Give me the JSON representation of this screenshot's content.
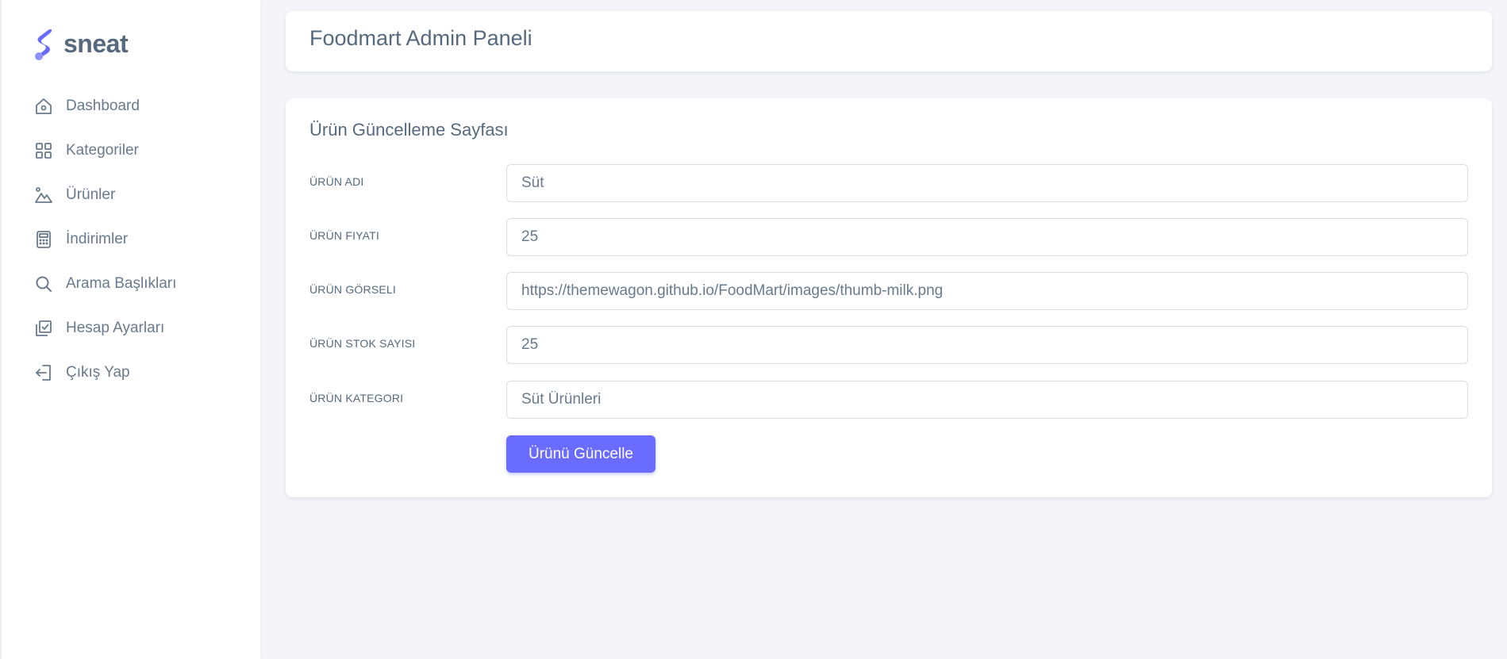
{
  "brand": {
    "name": "sneat",
    "accent_color": "#696cff"
  },
  "sidebar": {
    "items": [
      {
        "label": "Dashboard",
        "icon": "home-icon"
      },
      {
        "label": "Kategoriler",
        "icon": "grid-icon"
      },
      {
        "label": "Ürünler",
        "icon": "shapes-icon"
      },
      {
        "label": "İndirimler",
        "icon": "calculator-icon"
      },
      {
        "label": "Arama Başlıkları",
        "icon": "search-icon"
      },
      {
        "label": "Hesap Ayarları",
        "icon": "checkbox-icon"
      },
      {
        "label": "Çıkış Yap",
        "icon": "logout-icon"
      }
    ]
  },
  "header": {
    "title": "Foodmart Admin Paneli"
  },
  "form": {
    "title": "Ürün Güncelleme Sayfası",
    "fields": [
      {
        "label": "ÜRÜN ADI",
        "value": "Süt"
      },
      {
        "label": "ÜRÜN FIYATI",
        "value": "25"
      },
      {
        "label": "ÜRÜN GÖRSELI",
        "value": "https://themewagon.github.io/FoodMart/images/thumb-milk.png"
      },
      {
        "label": "ÜRÜN STOK SAYISI",
        "value": "25"
      },
      {
        "label": "ÜRÜN KATEGORI",
        "value": "Süt Ürünleri"
      }
    ],
    "submit_label": "Ürünü Güncelle"
  }
}
